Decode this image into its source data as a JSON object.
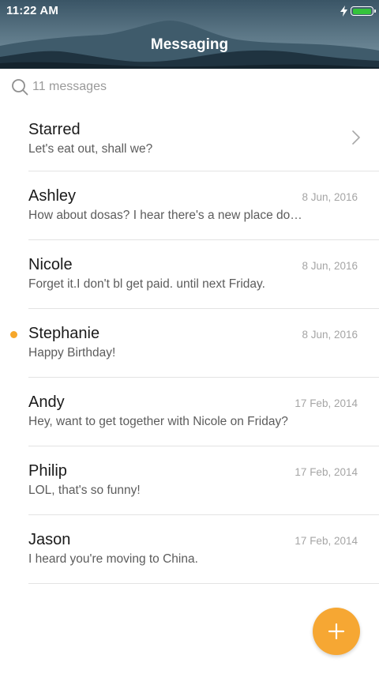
{
  "status_bar": {
    "time": "11:22 AM",
    "battery_level": 1.0,
    "charging": true
  },
  "header": {
    "title": "Messaging"
  },
  "search": {
    "placeholder": "11 messages"
  },
  "conversations": [
    {
      "name": "Starred",
      "preview": "Let's eat out, shall we?",
      "date": "",
      "has_chevron": true,
      "unread": false
    },
    {
      "name": "Ashley",
      "preview": "How about dosas? I hear there's a new place do…",
      "date": "8 Jun, 2016",
      "unread": false
    },
    {
      "name": "Nicole",
      "preview": "Forget it.I don't bl get paid. until next Friday.",
      "date": "8 Jun, 2016",
      "unread": false
    },
    {
      "name": "Stephanie",
      "preview": "Happy Birthday!",
      "date": "8 Jun, 2016",
      "unread": true
    },
    {
      "name": "Andy",
      "preview": "Hey, want to get together with Nicole on Friday?",
      "date": "17 Feb, 2014",
      "unread": false
    },
    {
      "name": "Philip",
      "preview": "LOL, that's so funny!",
      "date": "17 Feb, 2014",
      "unread": false
    },
    {
      "name": "Jason",
      "preview": "I heard you're moving to China.",
      "date": "17 Feb, 2014",
      "unread": false
    }
  ],
  "colors": {
    "accent": "#f6a733",
    "unread_dot": "#f6a72a",
    "battery": "#35c33c"
  },
  "fab": {
    "icon": "plus-icon"
  }
}
